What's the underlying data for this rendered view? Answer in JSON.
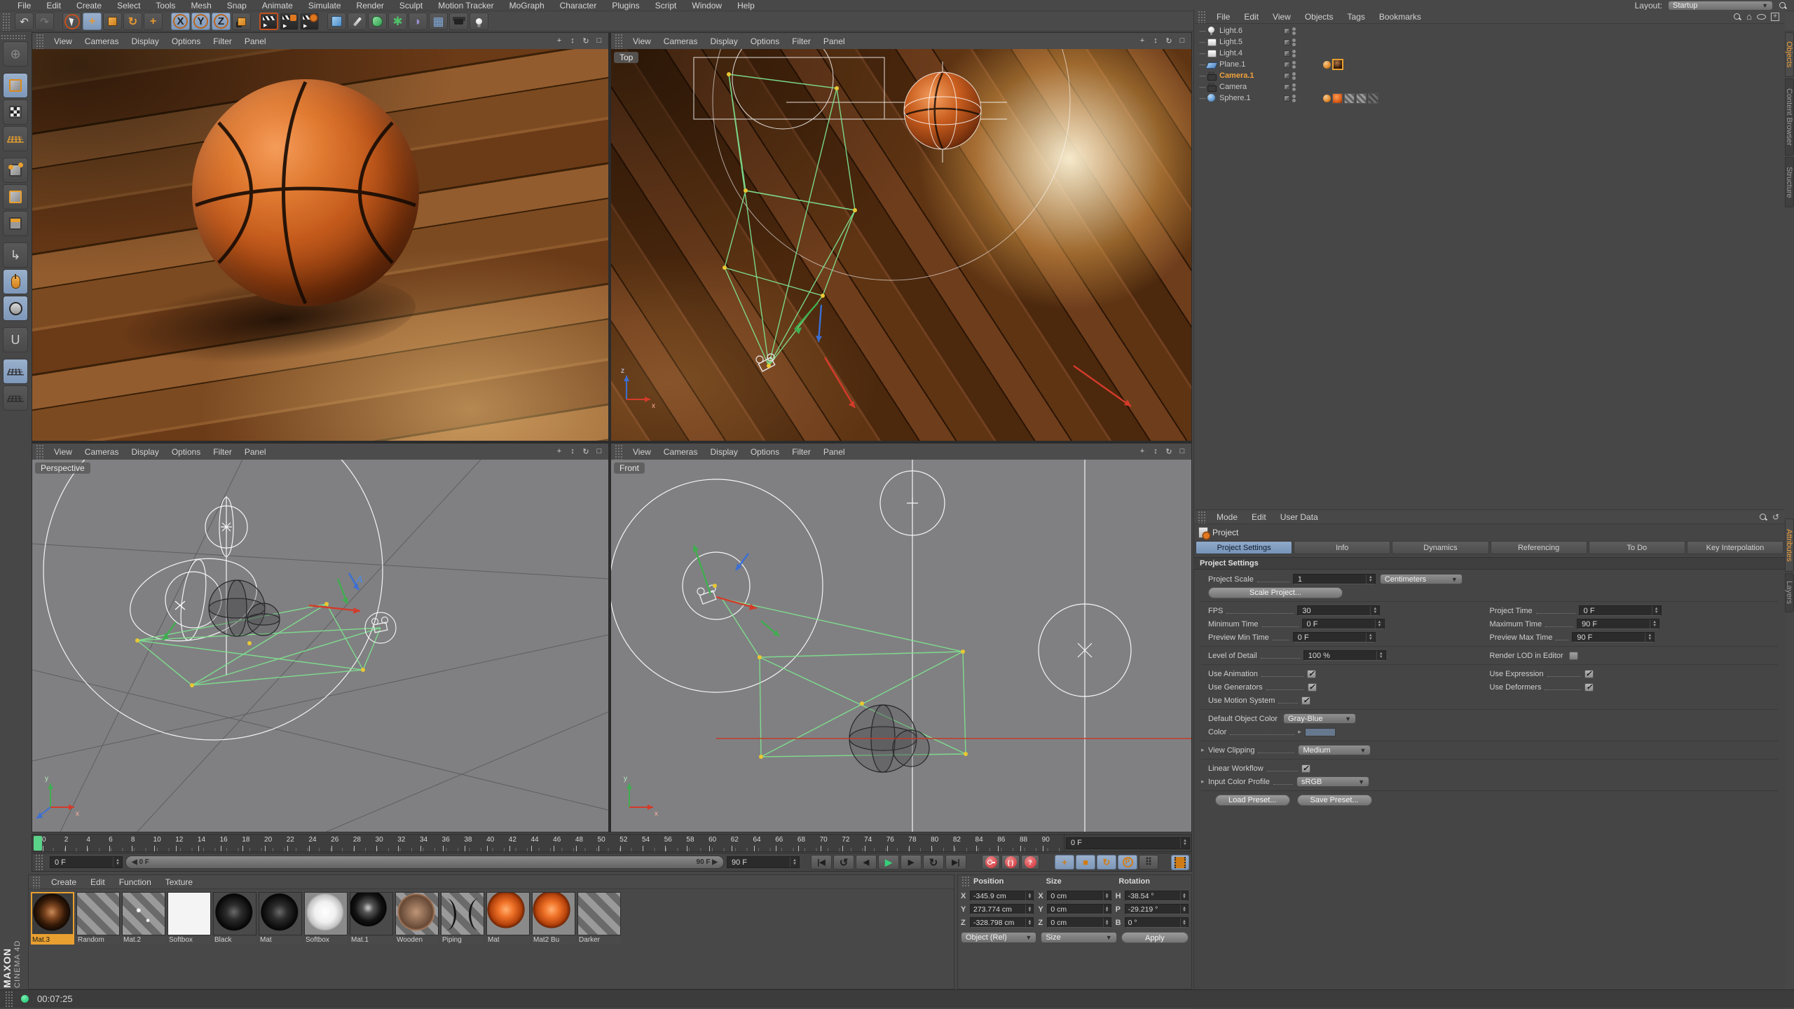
{
  "menubar": {
    "items": [
      "File",
      "Edit",
      "Create",
      "Select",
      "Tools",
      "Mesh",
      "Snap",
      "Animate",
      "Simulate",
      "Render",
      "Sculpt",
      "Motion Tracker",
      "MoGraph",
      "Character",
      "Plugins",
      "Script",
      "Window",
      "Help"
    ],
    "layout_label": "Layout:",
    "layout_value": "Startup"
  },
  "toolbar": {
    "buttons": [
      {
        "name": "undo-button",
        "glyph": "↶",
        "cls": "g"
      },
      {
        "name": "redo-button",
        "glyph": "↷",
        "cls": "dim"
      },
      {
        "name": "separator",
        "cls": "sep"
      },
      {
        "name": "live-selection-button",
        "cls": "cursor ring"
      },
      {
        "name": "move-button",
        "glyph": "+",
        "cls": "org bold active"
      },
      {
        "name": "scale-button",
        "cls": "scale-ico"
      },
      {
        "name": "rotate-button",
        "glyph": "↻",
        "cls": "org bold"
      },
      {
        "name": "last-tool-button",
        "glyph": "+",
        "cls": "org bold"
      },
      {
        "name": "separator",
        "cls": "sep"
      },
      {
        "name": "x-axis-lock-button",
        "glyph": "X",
        "cls": "axis active"
      },
      {
        "name": "y-axis-lock-button",
        "glyph": "Y",
        "cls": "axis active"
      },
      {
        "name": "z-axis-lock-button",
        "glyph": "Z",
        "cls": "axis active"
      },
      {
        "name": "coordinate-system-button",
        "cls": "coord-ico"
      },
      {
        "name": "separator",
        "cls": "sep"
      },
      {
        "name": "render-view-button",
        "cls": "clap marked"
      },
      {
        "name": "render-settings-button",
        "cls": "clap badge-box"
      },
      {
        "name": "render-queue-button",
        "cls": "clap badge-gear"
      },
      {
        "name": "separator",
        "cls": "sep"
      },
      {
        "name": "add-cube-button",
        "cls": "bluecube"
      },
      {
        "name": "spline-pen-button",
        "cls": "pen-ico"
      },
      {
        "name": "subdivision-surface-button",
        "cls": "subdiv-ico"
      },
      {
        "name": "deformer-button",
        "glyph": "✱",
        "cls": "grn big"
      },
      {
        "name": "spline-primitive-button",
        "glyph": "◗",
        "cls": "purp big"
      },
      {
        "name": "floor-button",
        "glyph": "▦",
        "cls": "blu big"
      },
      {
        "name": "camera-button",
        "cls": "cam-ico"
      },
      {
        "name": "light-button",
        "cls": "bulb-ico"
      }
    ]
  },
  "left_toolbar": {
    "buttons": [
      {
        "name": "make-editable-button",
        "glyph": "⊕",
        "cls": "dim",
        "inner": ""
      },
      {
        "name": "model-mode-button",
        "cls": "active m-active gap",
        "inner": "cube"
      },
      {
        "name": "texture-mode-button",
        "cls": "",
        "inner": "cube tex"
      },
      {
        "name": "workplane-mode-button",
        "cls": "",
        "inner": "gridi"
      },
      {
        "name": "points-mode-button",
        "cls": "gap",
        "inner": "cube pts"
      },
      {
        "name": "edges-mode-button",
        "cls": "",
        "inner": "cube edg"
      },
      {
        "name": "polygons-mode-button",
        "cls": "",
        "inner": "cube pol"
      },
      {
        "name": "object-axis-mode-button",
        "glyph": "↳",
        "cls": "gap org-glyph",
        "inner": ""
      },
      {
        "name": "tweak-mode-button",
        "cls": "active",
        "inner": "mouse"
      },
      {
        "name": "snap-button",
        "cls": "active",
        "inner": "scirc"
      },
      {
        "name": "magnet-button",
        "glyph": "U",
        "cls": "gap",
        "inner": "magnet-g"
      },
      {
        "name": "workplane-lock-button",
        "cls": "active gap",
        "inner": "gridg"
      },
      {
        "name": "workplane-align-button",
        "cls": "",
        "inner": "gridg rot"
      }
    ]
  },
  "viewport_menu": [
    "View",
    "Cameras",
    "Display",
    "Options",
    "Filter",
    "Panel"
  ],
  "viewport_icons": [
    {
      "name": "pan-icon",
      "glyph": "+"
    },
    {
      "name": "zoom-icon",
      "glyph": "↕"
    },
    {
      "name": "rotate-icon",
      "glyph": "↻"
    },
    {
      "name": "maximize-icon",
      "glyph": "□"
    }
  ],
  "viewports": {
    "top_right": {
      "label": "Top"
    },
    "bottom_left": {
      "label": "Perspective"
    },
    "bottom_right": {
      "label": "Front"
    }
  },
  "object_manager": {
    "menu": [
      "File",
      "Edit",
      "View",
      "Objects",
      "Tags",
      "Bookmarks"
    ],
    "items": [
      {
        "name": "Light.6",
        "icon": "oi-bulb",
        "state": "check",
        "sel": "",
        "tags": []
      },
      {
        "name": "Light.5",
        "icon": "oi-area",
        "state": "check",
        "sel": "",
        "tags": []
      },
      {
        "name": "Light.4",
        "icon": "oi-area",
        "state": "check",
        "sel": "",
        "tags": []
      },
      {
        "name": "Plane.1",
        "icon": "oi-plane",
        "state": "check",
        "sel": "",
        "tags": [
          "phong",
          "mat-dark"
        ]
      },
      {
        "name": "Camera.1",
        "icon": "oi-cam",
        "state": "target",
        "sel": "sel",
        "tags": []
      },
      {
        "name": "Camera",
        "icon": "oi-cam",
        "state": "target",
        "sel": "",
        "tags": []
      },
      {
        "name": "Sphere.1",
        "icon": "oi-sphere",
        "state": "check",
        "sel": "",
        "tags": [
          "phong",
          "mat-orange",
          "stripe",
          "stripe",
          "stripe-dark"
        ]
      }
    ]
  },
  "side_tabs": {
    "objects": "Objects",
    "content_browser": "Content Browser",
    "structure": "Structure",
    "attributes": "Attributes",
    "layers": "Layers"
  },
  "attributes": {
    "menu": [
      "Mode",
      "Edit",
      "User Data"
    ],
    "title": "Project",
    "tabs": [
      {
        "label": "Project Settings",
        "cls": "on"
      },
      {
        "label": "Info",
        "cls": ""
      },
      {
        "label": "Dynamics",
        "cls": ""
      },
      {
        "label": "Referencing",
        "cls": ""
      },
      {
        "label": "To Do",
        "cls": ""
      },
      {
        "label": "Key Interpolation",
        "cls": ""
      }
    ],
    "section": "Project Settings",
    "project_scale_label": "Project Scale",
    "project_scale_value": "1",
    "project_scale_unit": "Centimeters",
    "scale_project_button": "Scale Project...",
    "fps_label": "FPS",
    "fps_value": "30",
    "project_time_label": "Project Time",
    "project_time_value": "0 F",
    "minimum_time_label": "Minimum Time",
    "minimum_time_value": "0 F",
    "maximum_time_label": "Maximum Time",
    "maximum_time_value": "90 F",
    "preview_min_label": "Preview Min Time",
    "preview_min_value": "0 F",
    "preview_max_label": "Preview Max Time",
    "preview_max_value": "90 F",
    "lod_label": "Level of Detail",
    "lod_value": "100 %",
    "render_lod_label": "Render LOD in Editor",
    "use_animation_label": "Use Animation",
    "use_expression_label": "Use Expression",
    "use_generators_label": "Use Generators",
    "use_deformers_label": "Use Deformers",
    "use_motion_label": "Use Motion System",
    "default_color_label": "Default Object Color",
    "default_color_value": "Gray-Blue",
    "color_label": "Color",
    "color_swatch": "#66788e",
    "view_clipping_label": "View Clipping",
    "view_clipping_value": "Medium",
    "linear_workflow_label": "Linear Workflow",
    "input_profile_label": "Input Color Profile",
    "input_profile_value": "sRGB",
    "load_preset_button": "Load Preset...",
    "save_preset_button": "Save Preset...",
    "check_glyph": "✓"
  },
  "timeline": {
    "ticks": [
      "0",
      "2",
      "4",
      "6",
      "8",
      "10",
      "12",
      "14",
      "16",
      "18",
      "20",
      "22",
      "24",
      "26",
      "28",
      "30",
      "32",
      "34",
      "36",
      "38",
      "40",
      "42",
      "44",
      "46",
      "48",
      "50",
      "52",
      "54",
      "56",
      "58",
      "60",
      "62",
      "64",
      "66",
      "68",
      "70",
      "72",
      "74",
      "76",
      "78",
      "80",
      "82",
      "84",
      "86",
      "88",
      "90"
    ],
    "current_frame": "0 F",
    "range_min": "0 F",
    "range_max": "90 F",
    "slider_left": "◀ 0 F",
    "slider_right": "90 F ▶",
    "transport": [
      {
        "name": "goto-start-button",
        "glyph": "|◀",
        "cls": ""
      },
      {
        "name": "previous-key-button",
        "glyph": "↺",
        "cls": "big"
      },
      {
        "name": "previous-frame-button",
        "glyph": "◀",
        "cls": ""
      },
      {
        "name": "play-button",
        "glyph": "▶",
        "cls": "play"
      },
      {
        "name": "next-frame-button",
        "glyph": "▶",
        "cls": ""
      },
      {
        "name": "next-key-button",
        "glyph": "↻",
        "cls": "big"
      },
      {
        "name": "goto-end-button",
        "glyph": "▶|",
        "cls": ""
      }
    ],
    "record_buttons": [
      {
        "name": "record-keyframe-button",
        "cls": "key",
        "glyph": ""
      },
      {
        "name": "autokey-button",
        "cls": "paren",
        "glyph": "( )"
      },
      {
        "name": "record-options-button",
        "cls": "q",
        "glyph": "?"
      }
    ],
    "key_toggles": [
      {
        "name": "key-position-toggle",
        "glyph": "+",
        "cls": ""
      },
      {
        "name": "key-scale-toggle",
        "glyph": "■",
        "cls": ""
      },
      {
        "name": "key-rotation-toggle",
        "glyph": "↻",
        "cls": ""
      },
      {
        "name": "key-parameter-toggle",
        "glyph": "P",
        "cls": "circ"
      },
      {
        "name": "key-pla-toggle",
        "glyph": "⠿",
        "cls": "dots"
      }
    ]
  },
  "materials": {
    "menu": [
      "Create",
      "Edit",
      "Function",
      "Texture"
    ],
    "items": [
      {
        "label": "Mat.3",
        "cls": "m-brown",
        "sel": "sel"
      },
      {
        "label": "Random",
        "cls": "m-stripe",
        "sel": ""
      },
      {
        "label": "Mat.2",
        "cls": "m-sparkle",
        "sel": ""
      },
      {
        "label": "Softbox",
        "cls": "m-white",
        "sel": ""
      },
      {
        "label": "Black",
        "cls": "m-black",
        "sel": ""
      },
      {
        "label": "Mat",
        "cls": "m-black",
        "sel": ""
      },
      {
        "label": "Softbox",
        "cls": "m-whiteball",
        "sel": ""
      },
      {
        "label": "Mat.1",
        "cls": "m-gloss",
        "sel": ""
      },
      {
        "label": "Wooden",
        "cls": "m-wood",
        "sel": ""
      },
      {
        "label": "Piping",
        "cls": "m-piping",
        "sel": ""
      },
      {
        "label": "Mat",
        "cls": "m-orange",
        "sel": ""
      },
      {
        "label": "Mat2 Bu",
        "cls": "m-orange",
        "sel": ""
      },
      {
        "label": "Darker",
        "cls": "m-stripe",
        "sel": ""
      }
    ]
  },
  "coordinates": {
    "position_label": "Position",
    "size_label": "Size",
    "rotation_label": "Rotation",
    "pos_x_axis": "X",
    "pos_x": "-345.9 cm",
    "pos_y_axis": "Y",
    "pos_y": "273.774 cm",
    "pos_z_axis": "Z",
    "pos_z": "-328.798 cm",
    "size_x_axis": "X",
    "size_x": "0 cm",
    "size_y_axis": "Y",
    "size_y": "0 cm",
    "size_z_axis": "Z",
    "size_z": "0 cm",
    "rot_h_axis": "H",
    "rot_h": "-38.54 °",
    "rot_p_axis": "P",
    "rot_p": "-29.219 °",
    "rot_b_axis": "B",
    "rot_b": "0 °",
    "mode_value": "Object (Rel)",
    "size_mode_value": "Size",
    "apply_button": "Apply"
  },
  "status": {
    "time": "00:07:25"
  },
  "brand": {
    "maxon": "MAXON",
    "cinema": "CINEMA 4D"
  }
}
